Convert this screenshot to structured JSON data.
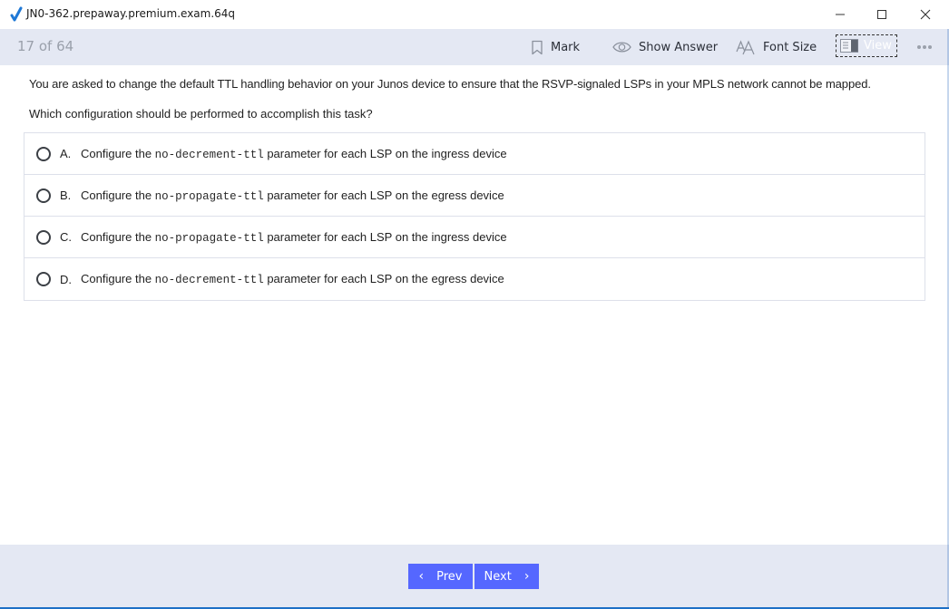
{
  "window": {
    "title": "JN0-362.prepaway.premium.exam.64q",
    "controls": {
      "minimize": "minimize-icon",
      "maximize": "maximize-icon",
      "close": "close-icon"
    }
  },
  "toolbar": {
    "counter": "17 of 64",
    "mark_label": "Mark",
    "show_answer_label": "Show Answer",
    "font_size_label": "Font Size",
    "view_label": "View",
    "icons": {
      "mark": "bookmark-icon",
      "show_answer": "eye-icon",
      "font_size": "font-size-icon",
      "view": "layout-view-icon",
      "more": "more-dots-icon"
    }
  },
  "question": {
    "text": "You are asked to change the default TTL handling behavior on your Junos device to ensure that the RSVP-signaled LSPs in your MPLS network cannot be mapped.",
    "prompt": "Which configuration should be performed to accomplish this task?",
    "options": [
      {
        "letter": "A.",
        "prefix": "Configure the ",
        "code": "no-decrement-ttl",
        "suffix": " parameter for each LSP on the ingress device",
        "selected": false
      },
      {
        "letter": "B.",
        "prefix": "Configure the ",
        "code": "no-propagate-ttl",
        "suffix": " parameter for each LSP on the egress device",
        "selected": false
      },
      {
        "letter": "C.",
        "prefix": "Configure the ",
        "code": "no-propagate-ttl",
        "suffix": " parameter for each LSP on the ingress device",
        "selected": false
      },
      {
        "letter": "D.",
        "prefix": "Configure the ",
        "code": "no-decrement-ttl",
        "suffix": " parameter for each LSP on the egress device",
        "selected": false
      }
    ]
  },
  "navigation": {
    "prev_label": "Prev",
    "next_label": "Next",
    "prev_chevron": "‹",
    "next_chevron": "›"
  },
  "colors": {
    "toolbar_bg": "#e4e8f3",
    "nav_button": "#5567ff",
    "app_check": "#1e78d6"
  }
}
